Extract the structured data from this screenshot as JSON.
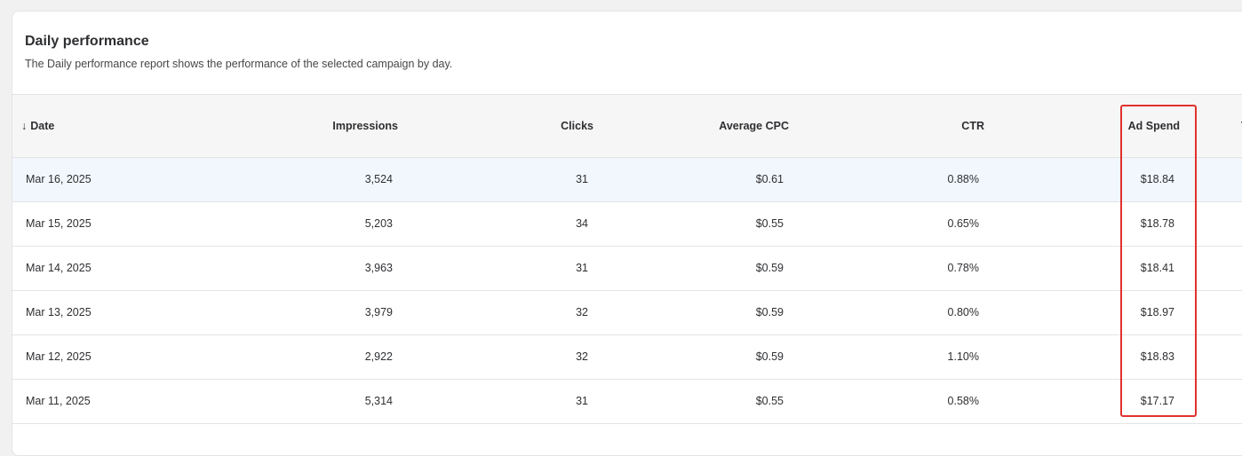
{
  "report": {
    "title": "Daily performance",
    "subtitle": "The Daily performance report shows the performance of the selected campaign by day."
  },
  "table": {
    "sort_arrow": "↓",
    "headers": {
      "date": "Date",
      "impressions": "Impressions",
      "clicks": "Clicks",
      "avg_cpc": "Average CPC",
      "ctr": "CTR",
      "ad_spend": "Ad Spend",
      "next_partial": "T"
    },
    "rows": [
      {
        "date": "Mar 16, 2025",
        "impressions": "3,524",
        "clicks": "31",
        "avg_cpc": "$0.61",
        "ctr": "0.88%",
        "ad_spend": "$18.84"
      },
      {
        "date": "Mar 15, 2025",
        "impressions": "5,203",
        "clicks": "34",
        "avg_cpc": "$0.55",
        "ctr": "0.65%",
        "ad_spend": "$18.78"
      },
      {
        "date": "Mar 14, 2025",
        "impressions": "3,963",
        "clicks": "31",
        "avg_cpc": "$0.59",
        "ctr": "0.78%",
        "ad_spend": "$18.41"
      },
      {
        "date": "Mar 13, 2025",
        "impressions": "3,979",
        "clicks": "32",
        "avg_cpc": "$0.59",
        "ctr": "0.80%",
        "ad_spend": "$18.97"
      },
      {
        "date": "Mar 12, 2025",
        "impressions": "2,922",
        "clicks": "32",
        "avg_cpc": "$0.59",
        "ctr": "1.10%",
        "ad_spend": "$18.83"
      },
      {
        "date": "Mar 11, 2025",
        "impressions": "5,314",
        "clicks": "31",
        "avg_cpc": "$0.55",
        "ctr": "0.58%",
        "ad_spend": "$17.17"
      }
    ]
  },
  "colors": {
    "highlight_box": "#e0322d",
    "selected_row": "#f2f7fd",
    "header_bg": "#f6f6f6"
  }
}
